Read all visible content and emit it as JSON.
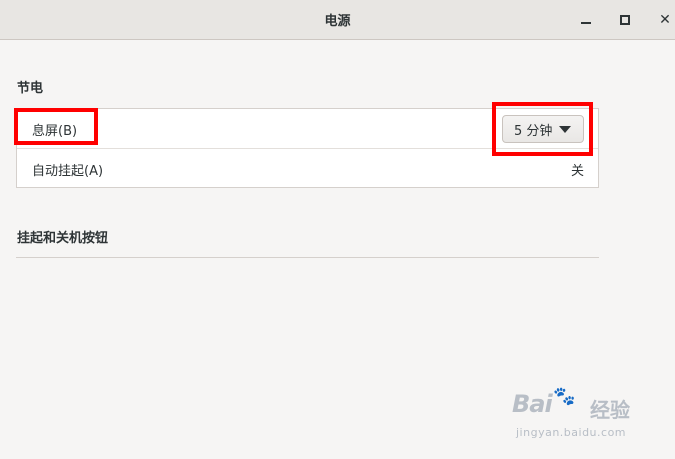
{
  "window": {
    "title": "电源"
  },
  "sections": {
    "power_saving": {
      "heading": "节电",
      "blank_screen": {
        "label": "息屏(B)",
        "value": "5 分钟"
      },
      "auto_suspend": {
        "label": "自动挂起(A)",
        "value": "关"
      }
    },
    "suspend_power_button": {
      "heading": "挂起和关机按钮"
    }
  },
  "watermark": {
    "logo": "Bai",
    "logo_suffix": "经验",
    "url": "jingyan.baidu.com"
  },
  "colors": {
    "highlight": "#ff0000",
    "titlebar": "#e8e6e3",
    "background": "#f6f5f4"
  }
}
